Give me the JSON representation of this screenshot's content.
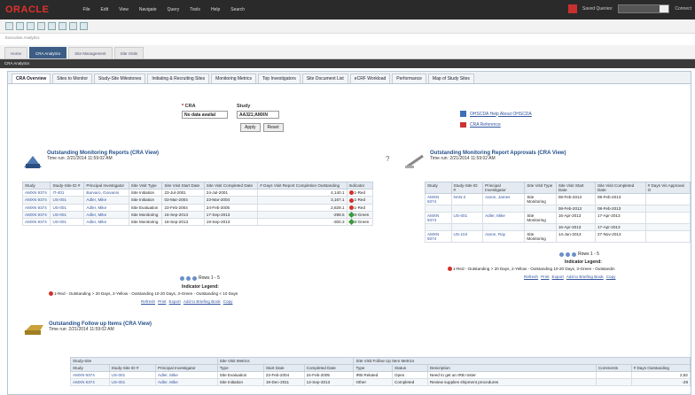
{
  "app": {
    "logo": "ORACLE",
    "menu": [
      "File",
      "Edit",
      "View",
      "Navigate",
      "Query",
      "Tools",
      "Help",
      "Search"
    ],
    "saved_queries_label": "Saved Queries:",
    "connect_label": "Connect"
  },
  "breadcrumb": "Executive Analytics",
  "nav_tabs": [
    "Home",
    "CRA Analytics",
    "Site Management",
    "Site Visits"
  ],
  "dark_bar": "CRA Analytics",
  "subtabs": [
    "CRA Overview",
    "Sites to Monitor",
    "Study-Site Milestones",
    "Initiating & Recruiting Sites",
    "Monitoring Metrics",
    "Top Investigators",
    "Site Document List",
    "eCRF Workload",
    "Performance",
    "Map of Study Sites"
  ],
  "filters": {
    "cra_label": "CRA",
    "cra_value": "No data availal",
    "study_label": "Study",
    "study_value": "AA321;AMXN",
    "apply": "Apply",
    "reset": "Reset"
  },
  "help_links": {
    "help": "OHSCDA Help About OHSCDA",
    "ref": "CRA Reference"
  },
  "left_report": {
    "title": "Outstanding Monitoring Reports (CRA View)",
    "time_run": "Time run: 2/21/2014 11:59:02 AM",
    "headers": [
      "Study",
      "Study-Site ID #",
      "Principal Investigator",
      "Site Visit Type",
      "Site Visit Start Date",
      "Site Visit Completed Date",
      "# Days Visit Report Completion Outstanding",
      "Indicator"
    ],
    "rows": [
      [
        "AMXN 9374",
        "IT-401",
        "Barvaro, Giovanni",
        "Site Initiation",
        "23-Jul-2001",
        "24-Jul-2001",
        "4,140.1",
        "1-Red"
      ],
      [
        "AMXN 9374",
        "US-001",
        "Adler, Mike",
        "Site Initiation",
        "03-Mar-2004",
        "23-Mar-2004",
        "3,167.1",
        "1-Red"
      ],
      [
        "AMXN 9374",
        "US-001",
        "Adler, Mike",
        "Site Evaluation",
        "23-Feb-2004",
        "24-Feb-2005",
        "2,829.1",
        "1-Red"
      ],
      [
        "AMXN 9374",
        "US-001",
        "Adler, Mike",
        "Site Monitoring",
        "16-Sep-2013",
        "17-Sep-2013",
        "-298.5",
        "3-Green"
      ],
      [
        "AMXN 9374",
        "US-001",
        "Adler, Mike",
        "Site Monitoring",
        "18-Sep-2013",
        "19-Sep-2013",
        "-300.3",
        "3-Green"
      ]
    ],
    "rows_label": "Rows 1 - 5",
    "legend_title": "Indicator Legend:",
    "legend": "1-Red - Outstanding > 20 Days, 2-Yellow - Outstanding 10-20 Days, 3-Green - Outstanding < 10 Days",
    "actions": [
      "Refresh",
      "Print",
      "Export",
      "Add to Briefing Book",
      "Copy"
    ]
  },
  "right_report": {
    "title": "Outstanding Monitoring Report Approvals (CRA View)",
    "time_run": "Time run: 2/21/2014 11:59:02 AM",
    "headers": [
      "Study",
      "Study-Site ID #",
      "Principal Investigator",
      "Site Visit Type",
      "Site Visit Start Date",
      "Site Visit Completed Date",
      "# Days Vis Approval O"
    ],
    "rows": [
      [
        "AMXN 9374",
        "NAN-2",
        "Aaron, James",
        "Site Monitoring",
        "08-Feb-2013",
        "08-Feb-2013",
        ""
      ],
      [
        "",
        "",
        "",
        "",
        "08-Feb-2013",
        "08-Feb-2013",
        ""
      ],
      [
        "AMXN 9374",
        "US-001",
        "Adler, Mike",
        "Site Monitoring",
        "16-Apr-2013",
        "17-Apr-2013",
        ""
      ],
      [
        "",
        "",
        "",
        "",
        "16-Apr-2013",
        "17-Apr-2013",
        ""
      ],
      [
        "AMXN 9374",
        "US-104",
        "Aaron, Ray",
        "Site Monitoring",
        "14-Jun-2013",
        "27-Nov-2013",
        ""
      ]
    ],
    "rows_label": "Rows 1 - 5",
    "legend_title": "Indicator Legend:",
    "legend": "1-Red - Outstanding > 20 Days, 2-Yellow - Outstanding 10-20 Days, 3-Green - Outstandin",
    "actions": [
      "Refresh",
      "Print",
      "Export",
      "Add to Briefing Book",
      "Copy"
    ]
  },
  "followup": {
    "title": "Outstanding Follow up Items (CRA View)",
    "time_run": "Time run: 2/21/2014 11:59:02 AM",
    "group_headers": [
      "Study-Site",
      "Site Visit Metrics",
      "Site Visit Follow Up Item Metrics"
    ],
    "headers": [
      "Study",
      "Study-Site ID #",
      "Principal Investigator",
      "Type",
      "Start Date",
      "Completed Date",
      "Type",
      "Status",
      "Description",
      "Comments",
      "# Days Outstanding"
    ],
    "rows": [
      [
        "AMXN 9374",
        "US-001",
        "Adler, Mike",
        "Site Evaluation",
        "23-Feb-2004",
        "24-Feb-2005",
        "IRB Related",
        "Open",
        "Need to get an IRB roster",
        "",
        "2,82"
      ],
      [
        "AMXN 9374",
        "US-001",
        "Adler, Mike",
        "Site Initiation",
        "19-Dec-2011",
        "13-Sep-2013",
        "Other",
        "Completed",
        "Review supplies shipment procedures",
        "",
        "-29"
      ]
    ]
  }
}
